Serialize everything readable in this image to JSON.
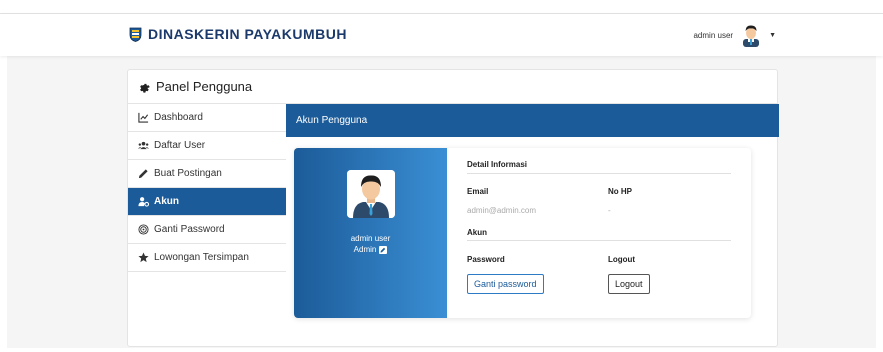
{
  "navbar": {
    "brand": "DINASKERIN PAYAKUMBUH",
    "user_name": "admin user"
  },
  "panel": {
    "title": "Panel Pengguna"
  },
  "sidebar": {
    "items": [
      {
        "label": "Dashboard",
        "icon": "chart-line-icon",
        "active": false
      },
      {
        "label": "Daftar User",
        "icon": "users-icon",
        "active": false
      },
      {
        "label": "Buat Postingan",
        "icon": "pencil-icon",
        "active": false
      },
      {
        "label": "Akun",
        "icon": "user-cog-icon",
        "active": true
      },
      {
        "label": "Ganti Password",
        "icon": "fingerprint-icon",
        "active": false
      },
      {
        "label": "Lowongan Tersimpan",
        "icon": "star-icon",
        "active": false
      }
    ]
  },
  "main": {
    "header": "Akun Pengguna",
    "profile": {
      "name": "admin user",
      "role": "Admin"
    },
    "detail": {
      "section_title": "Detail Informasi",
      "email_label": "Email",
      "email_value": "admin@admin.com",
      "phone_label": "No HP",
      "phone_value": "-",
      "account_title": "Akun",
      "password_label": "Password",
      "password_button": "Ganti password",
      "logout_label": "Logout",
      "logout_button": "Logout"
    }
  },
  "colors": {
    "primary": "#1c5b99",
    "gradient_end": "#3a8fd4",
    "brand_text": "#1b3a6b"
  }
}
